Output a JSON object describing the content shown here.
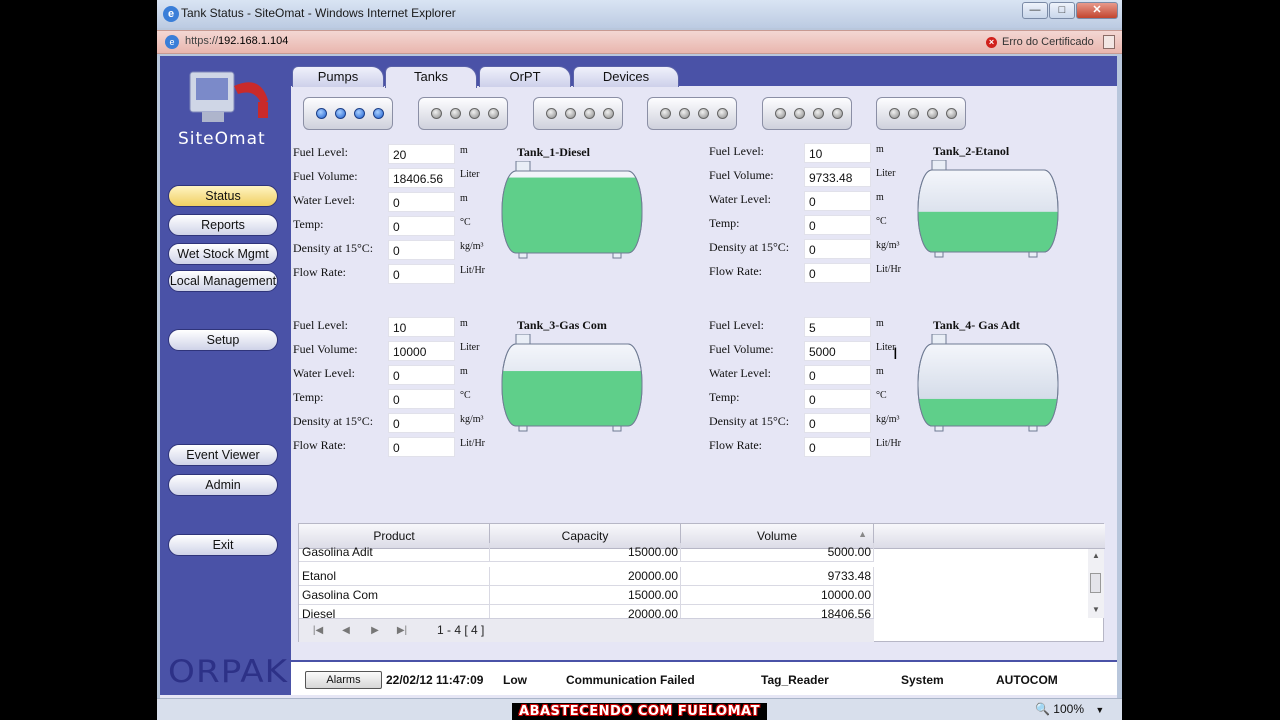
{
  "window": {
    "title": "Tank Status - SiteOmat - Windows Internet Explorer",
    "address": "192.168.1.104",
    "address_prefix": "https://",
    "cert_error": "Erro do Certificado",
    "zoom": "100%"
  },
  "sidebar": {
    "logo": "SiteOmat",
    "brand": "ORPAK",
    "items": [
      {
        "label": "Status",
        "active": true
      },
      {
        "label": "Reports"
      },
      {
        "label": "Wet Stock Mgmt"
      },
      {
        "label": "Local Management"
      },
      {
        "label": "Setup"
      },
      {
        "label": "Event Viewer"
      },
      {
        "label": "Admin"
      },
      {
        "label": "Exit"
      }
    ]
  },
  "tabs": [
    "Pumps",
    "Tanks",
    "OrPT",
    "Devices"
  ],
  "active_tab": "Tanks",
  "field_labels": {
    "fuel_level": "Fuel Level:",
    "fuel_volume": "Fuel Volume:",
    "water_level": "Water Level:",
    "temp": "Temp:",
    "density": "Density at 15°C:",
    "flow_rate": "Flow Rate:"
  },
  "units": {
    "fuel_level": "m",
    "fuel_volume": "Liter",
    "water_level": "m",
    "temp": "°C",
    "density": "kg/m³",
    "flow_rate": "Lit/Hr"
  },
  "tanks": [
    {
      "name": "Tank_1-Diesel",
      "fuel_level": "20",
      "fuel_volume": "18406.56",
      "water_level": "0",
      "temp": "0",
      "density": "0",
      "flow_rate": "0",
      "fill_fraction": 0.92
    },
    {
      "name": "Tank_2-Etanol",
      "fuel_level": "10",
      "fuel_volume": "9733.48",
      "water_level": "0",
      "temp": "0",
      "density": "0",
      "flow_rate": "0",
      "fill_fraction": 0.49
    },
    {
      "name": "Tank_3-Gas Com",
      "fuel_level": "10",
      "fuel_volume": "10000",
      "water_level": "0",
      "temp": "0",
      "density": "0",
      "flow_rate": "0",
      "fill_fraction": 0.67
    },
    {
      "name": "Tank_4- Gas Adt",
      "fuel_level": "5",
      "fuel_volume": "5000",
      "water_level": "0",
      "temp": "0",
      "density": "0",
      "flow_rate": "0",
      "fill_fraction": 0.33
    }
  ],
  "colors": {
    "fuel": "#5fcf8a",
    "sidebar": "#4a52a7",
    "content_bg": "#e6e6f5",
    "active_nav": "#f0cf62",
    "pump_lit": "#1c5fd0"
  },
  "pump_groups": [
    {
      "lit": true
    },
    {
      "lit": false
    },
    {
      "lit": false
    },
    {
      "lit": false
    },
    {
      "lit": false
    },
    {
      "lit": false
    }
  ],
  "grid": {
    "headers": [
      "Product",
      "Capacity",
      "Volume"
    ],
    "rows": [
      [
        "Gasolina Adit",
        "15000.00",
        "5000.00"
      ],
      [
        "Etanol",
        "20000.00",
        "9733.48"
      ],
      [
        "Gasolina Com",
        "15000.00",
        "10000.00"
      ],
      [
        "Diesel",
        "20000.00",
        "18406.56"
      ]
    ],
    "page_info": "1 - 4  [ 4 ]"
  },
  "alarm": {
    "button": "Alarms",
    "datetime": "22/02/12 11:47:09",
    "severity": "Low",
    "message": "Communication Failed",
    "device": "Tag_Reader",
    "category": "System",
    "source": "AUTOCOM"
  },
  "caption": "ABASTECENDO COM FUELOMAT"
}
